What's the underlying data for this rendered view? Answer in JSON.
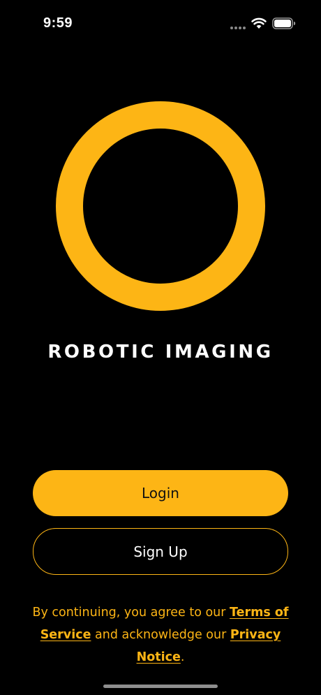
{
  "status_bar": {
    "time": "9:59",
    "icons": [
      "cellular-dots-icon",
      "wifi-icon",
      "battery-icon"
    ]
  },
  "brand": {
    "logo_icon": "ring-logo-icon",
    "title": "ROBOTIC IMAGING",
    "accent_color": "#FDB515",
    "background_color": "#000000"
  },
  "actions": {
    "login_label": "Login",
    "signup_label": "Sign Up"
  },
  "legal": {
    "prefix": "By continuing, you agree to our ",
    "terms_link": "Terms of Service",
    "middle": " and acknowledge our ",
    "privacy_link": "Privacy Notice",
    "suffix": "."
  }
}
